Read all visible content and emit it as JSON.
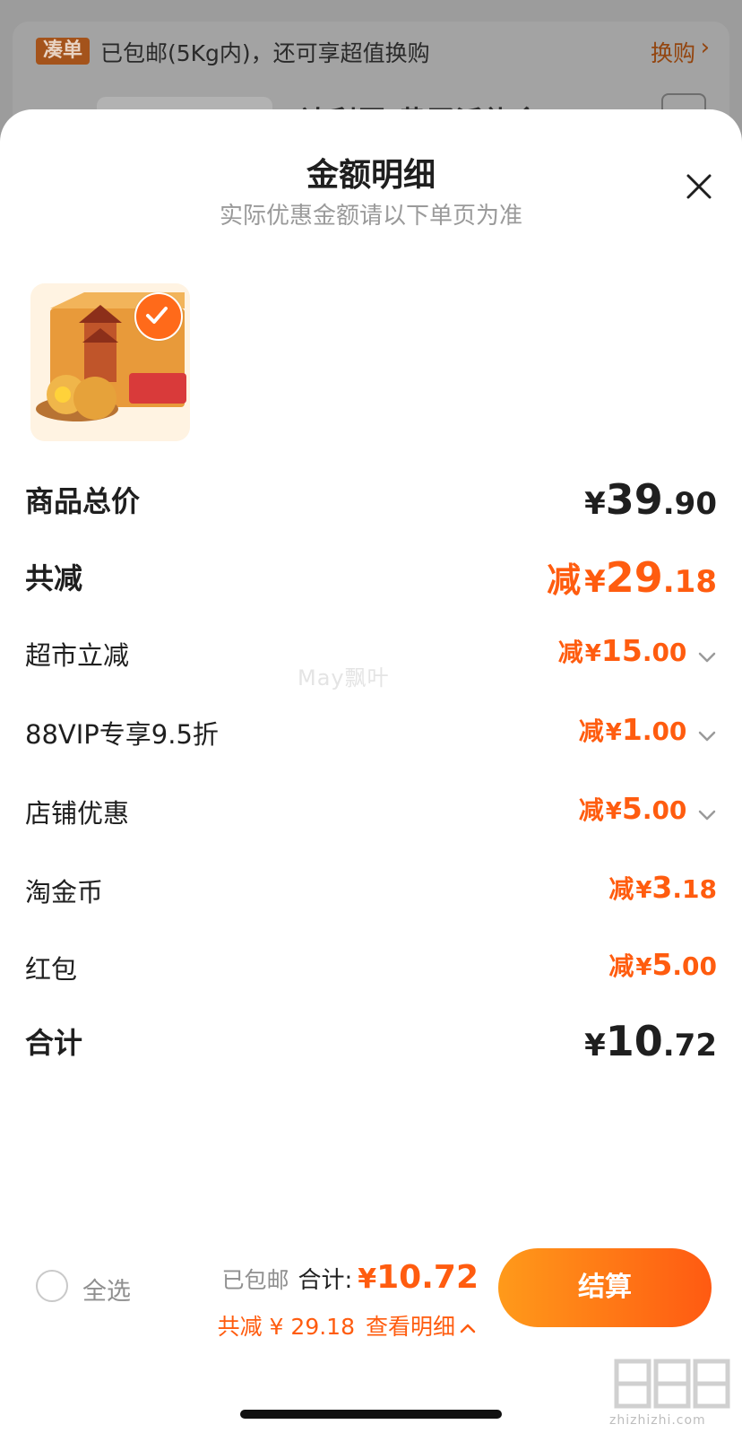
{
  "background": {
    "tag": "凑单",
    "banner_text": "已包邮(5Kg内)，还可享超值换购",
    "banner_link": "换购",
    "product_title_partial": "达利园 黄蛋派礼盒"
  },
  "sheet": {
    "title": "金额明细",
    "subtitle": "实际优惠金额请以下单页为准"
  },
  "breakdown": {
    "goods_total": {
      "label": "商品总价",
      "yen": "¥",
      "int": "39",
      "dec": ".90"
    },
    "total_discount": {
      "label": "共减",
      "prefix": "减",
      "yen": "¥",
      "int": "29",
      "dec": ".18"
    },
    "items": [
      {
        "label": "超市立减",
        "prefix": "减",
        "yen": "¥",
        "int": "15",
        "dec": ".00",
        "expandable": true
      },
      {
        "label": "88VIP专享9.5折",
        "prefix": "减",
        "yen": "¥",
        "int": "1",
        "dec": ".00",
        "expandable": true
      },
      {
        "label": "店铺优惠",
        "prefix": "减",
        "yen": "¥",
        "int": "5",
        "dec": ".00",
        "expandable": true
      },
      {
        "label": "淘金币",
        "prefix": "减",
        "yen": "¥",
        "int": "3",
        "dec": ".18",
        "expandable": false
      },
      {
        "label": "红包",
        "prefix": "减",
        "yen": "¥",
        "int": "5",
        "dec": ".00",
        "expandable": false
      }
    ],
    "grand_total": {
      "label": "合计",
      "yen": "¥",
      "int": "10",
      "dec": ".72"
    }
  },
  "watermark": "May飘叶",
  "bottom_bar": {
    "select_all": "全选",
    "free_shipping": "已包邮",
    "total_label": "合计:",
    "total_yen": "¥",
    "total_amount": "10.72",
    "discount_line": "共减 ¥ 29.18",
    "view_detail": "查看明细",
    "checkout": "结算"
  },
  "colors": {
    "accent": "#ff5c0f",
    "checkout_gradient_start": "#ff9a1a",
    "checkout_gradient_end": "#ff5a12"
  },
  "corner_logo_text": "zhizhizhi.com"
}
